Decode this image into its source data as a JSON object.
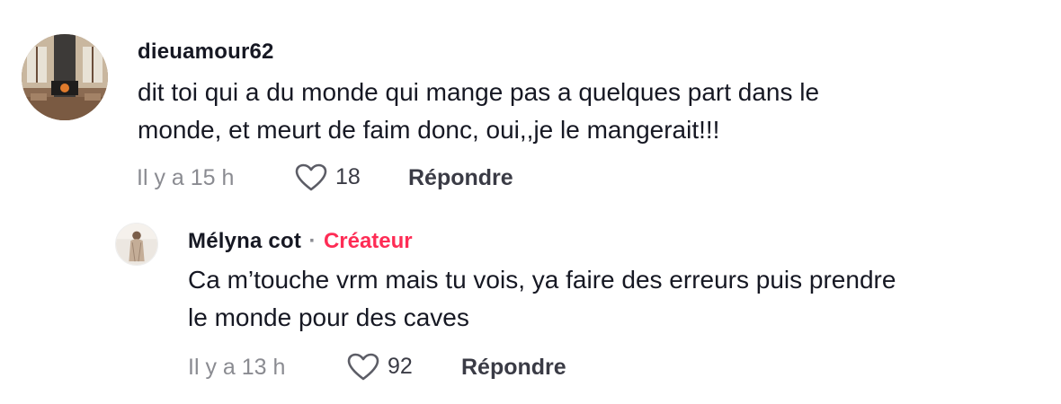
{
  "comment": {
    "username": "dieuamour62",
    "text_line1": "dit toi qui a du monde qui mange pas a quelques part dans le",
    "text_line2": "monde, et meurt de faim donc, oui,,je le mangerait!!!",
    "time": "Il y a 15 h",
    "likes": "18",
    "reply_label": "Répondre",
    "avatar_icon": "cabin-fireplace-avatar-icon",
    "heart_icon": "heart-outline-icon"
  },
  "reply": {
    "username": "Mélyna cot",
    "separator": "·",
    "badge": "Créateur",
    "text_line1": "Ca m’touche vrm mais tu vois, ya faire des erreurs puis prendre",
    "text_line2": "le monde pour des caves",
    "time": "Il y a 13 h",
    "likes": "92",
    "reply_label": "Répondre",
    "avatar_icon": "person-photo-avatar-icon",
    "heart_icon": "heart-outline-icon"
  },
  "colors": {
    "creator_badge": "#fe2c55",
    "meta_gray": "#8a8b91",
    "text_dark": "#161823"
  }
}
